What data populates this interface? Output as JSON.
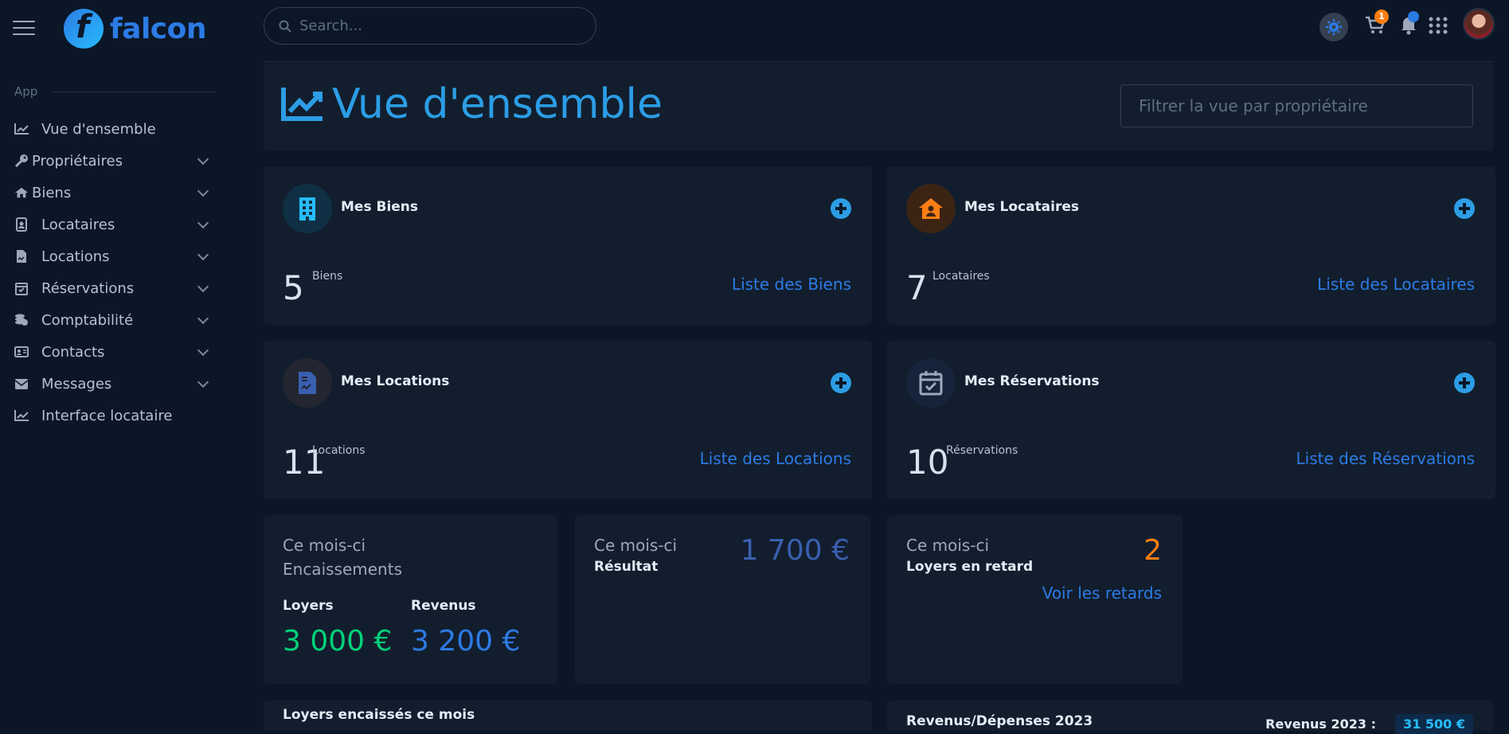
{
  "topbar": {
    "brand": "falcon",
    "search_placeholder": "Search...",
    "cart_count": "1"
  },
  "sidebar": {
    "section_label": "App",
    "items": [
      {
        "label": "Vue d'ensemble",
        "icon": "chart-line-icon"
      },
      {
        "label": "Propriétaires",
        "icon": "key-icon"
      },
      {
        "label": "Biens",
        "icon": "home-icon"
      },
      {
        "label": "Locataires",
        "icon": "id-badge-icon"
      },
      {
        "label": "Locations",
        "icon": "file-contract-icon"
      },
      {
        "label": "Réservations",
        "icon": "calendar-check-icon"
      },
      {
        "label": "Comptabilité",
        "icon": "coins-icon"
      },
      {
        "label": "Contacts",
        "icon": "address-card-icon"
      },
      {
        "label": "Messages",
        "icon": "mail-bulk-icon"
      },
      {
        "label": "Interface locataire",
        "icon": "chart-line-icon"
      }
    ]
  },
  "header": {
    "title": "Vue d'ensemble",
    "filter_placeholder": "Filtrer la vue par propriétaire"
  },
  "cards": {
    "biens": {
      "title": "Mes Biens",
      "count": "5",
      "unit": "Biens",
      "link": "Liste des Biens",
      "icon_color": "#27bcfd",
      "icon_bg": "#0f3044"
    },
    "locataires": {
      "title": "Mes Locataires",
      "count": "7",
      "unit": "Locataires",
      "link": "Liste des Locataires",
      "icon_color": "#fd7e14",
      "icon_bg": "#3c2414"
    },
    "locations": {
      "title": "Mes Locations",
      "count": "11",
      "unit": "Locations",
      "link": "Liste des Locations",
      "icon_color": "#3a5fb0",
      "icon_bg": "#232630"
    },
    "reservations": {
      "title": "Mes Réservations",
      "count": "10",
      "unit": "Réservations",
      "link": "Liste des Réservations",
      "icon_color": "#9da9bb",
      "icon_bg": "#15243a"
    }
  },
  "encaissements": {
    "period": "Ce mois-ci",
    "title": "Encaissements",
    "loyers_label": "Loyers",
    "loyers_value": "3 000 €",
    "revenus_label": "Revenus",
    "revenus_value": "3 200 €"
  },
  "resultat": {
    "period": "Ce mois-ci",
    "title": "Résultat",
    "value": "1 700 €"
  },
  "retards": {
    "period": "Ce mois-ci",
    "title": "Loyers en retard",
    "value": "2",
    "link": "Voir les retards"
  },
  "bottom": {
    "left_title": "Loyers encaissés ce mois",
    "right_title": "Revenus/Dépenses 2023",
    "revenus_label": "Revenus 2023 :",
    "revenus_value": "31 500 €"
  },
  "colors": {
    "accent": "#2c7be5",
    "green": "#00d27a",
    "orange": "#fd7e14"
  }
}
